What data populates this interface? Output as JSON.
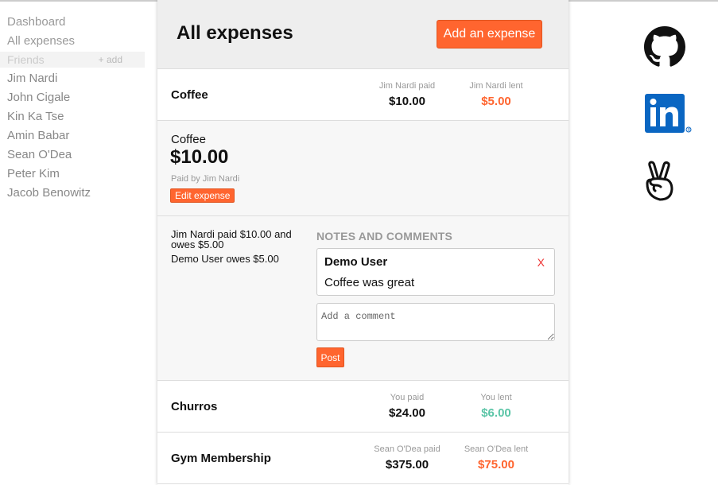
{
  "sidebar": {
    "dashboard": "Dashboard",
    "all_expenses": "All expenses",
    "friends_title": "Friends",
    "friends_add": "+ add",
    "friends": [
      "Jim Nardi",
      "John Cigale",
      "Kin Ka Tse",
      "Amin Babar",
      "Sean O'Dea",
      "Peter Kim",
      "Jacob Benowitz"
    ]
  },
  "main": {
    "title": "All expenses",
    "add_button": "Add an expense"
  },
  "expenses": [
    {
      "name": "Coffee",
      "paid_label": "Jim Nardi paid",
      "paid_amount": "$10.00",
      "lent_label": "Jim Nardi lent",
      "lent_amount": "$5.00"
    },
    {
      "name": "Churros",
      "paid_label": "You paid",
      "paid_amount": "$24.00",
      "lent_label": "You lent",
      "lent_amount": "$6.00"
    },
    {
      "name": "Gym Membership",
      "paid_label": "Sean O'Dea paid",
      "paid_amount": "$375.00",
      "lent_label": "Sean O'Dea lent",
      "lent_amount": "$75.00"
    }
  ],
  "detail": {
    "name": "Coffee",
    "amount": "$10.00",
    "paid_by": "Paid by Jim Nardi",
    "edit_button": "Edit expense",
    "summary": [
      "Jim Nardi paid $10.00 and owes $5.00",
      "Demo User owes $5.00"
    ],
    "notes_title": "NOTES AND COMMENTS",
    "comment": {
      "author": "Demo User",
      "delete": "X",
      "text": "Coffee was great"
    },
    "comment_placeholder": "Add a comment",
    "post_button": "Post"
  },
  "colors": {
    "accent": "#ff652f",
    "positive": "#5bc5a7",
    "linkedin": "#0a66c2"
  },
  "icons": {
    "github": "github-icon",
    "linkedin": "linkedin-icon",
    "angellist": "angellist-icon"
  }
}
